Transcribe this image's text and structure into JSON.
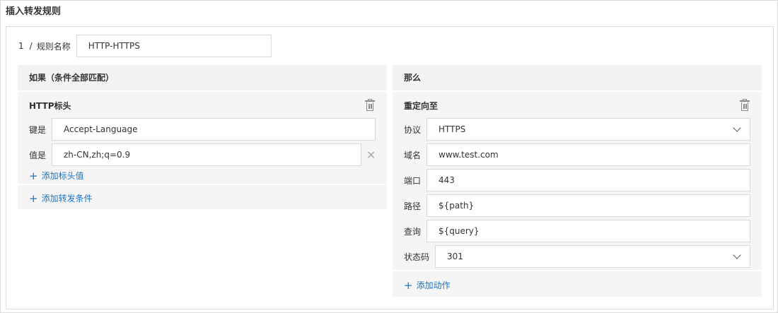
{
  "title": "插入转发规则",
  "rule": {
    "index": "1",
    "separator": "/",
    "name_label": "规则名称",
    "name_value": "HTTP-HTTPS"
  },
  "conditions": {
    "header": "如果（条件全部匹配）",
    "items": [
      {
        "type_label": "HTTP标头",
        "key_label": "键是",
        "key_value": "Accept-Language",
        "value_label": "值是",
        "value_value": "zh-CN,zh;q=0.9",
        "add_value_label": "添加标头值"
      }
    ],
    "add_condition_label": "添加转发条件"
  },
  "actions": {
    "header": "那么",
    "items": [
      {
        "type_label": "重定向至",
        "protocol_label": "协议",
        "protocol_value": "HTTPS",
        "domain_label": "域名",
        "domain_value": "www.test.com",
        "port_label": "端口",
        "port_value": "443",
        "path_label": "路径",
        "path_value": "${path}",
        "query_label": "查询",
        "query_value": "${query}",
        "status_label": "状态码",
        "status_value": "301"
      }
    ],
    "add_action_label": "添加动作"
  },
  "icons": {
    "delete": "trash-icon",
    "remove": "close-icon",
    "add": "plus-icon",
    "dropdown": "chevron-down-icon"
  },
  "colors": {
    "link": "#1a73c6",
    "panel_bg": "#f5f5f5",
    "border": "#d9d9d9"
  }
}
